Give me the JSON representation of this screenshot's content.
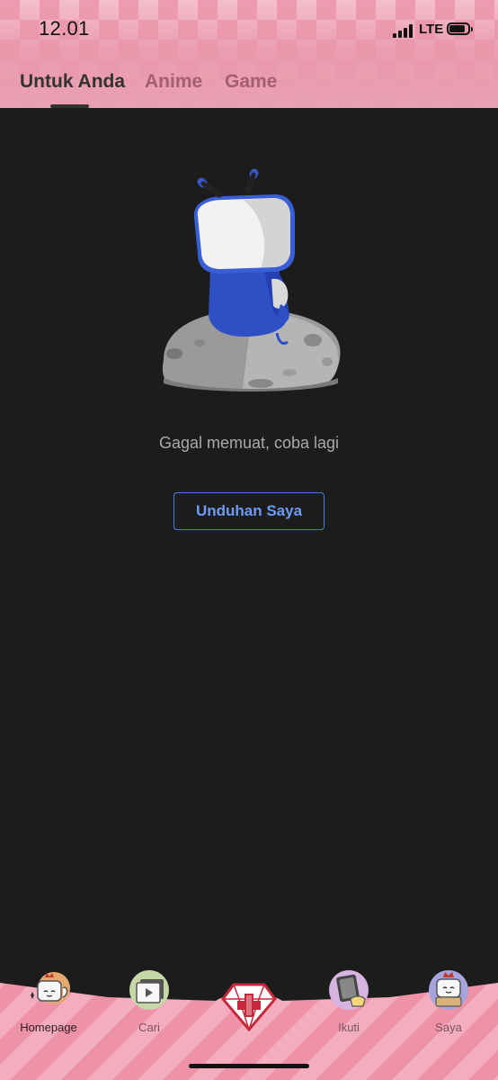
{
  "status_bar": {
    "time": "12.01",
    "network": "LTE"
  },
  "tabs": [
    {
      "label": "Untuk Anda",
      "active": true
    },
    {
      "label": "Anime",
      "active": false
    },
    {
      "label": "Game",
      "active": false
    }
  ],
  "main": {
    "error_message": "Gagal memuat, coba lagi",
    "download_button": "Unduhan Saya"
  },
  "bottom_nav": [
    {
      "label": "Homepage",
      "icon": "mascot-flex-icon",
      "active": true
    },
    {
      "label": "Cari",
      "icon": "video-play-icon",
      "active": false
    },
    {
      "label": "",
      "icon": "diamond-plus-icon",
      "active": false
    },
    {
      "label": "Ikuti",
      "icon": "tablet-hand-icon",
      "active": false
    },
    {
      "label": "Saya",
      "icon": "mascot-crown-icon",
      "active": false
    }
  ],
  "colors": {
    "header_pink": "#ee9bb0",
    "background": "#1c1c1c",
    "accent_blue": "#4a79e6",
    "tab_inactive": "#a45e70"
  }
}
